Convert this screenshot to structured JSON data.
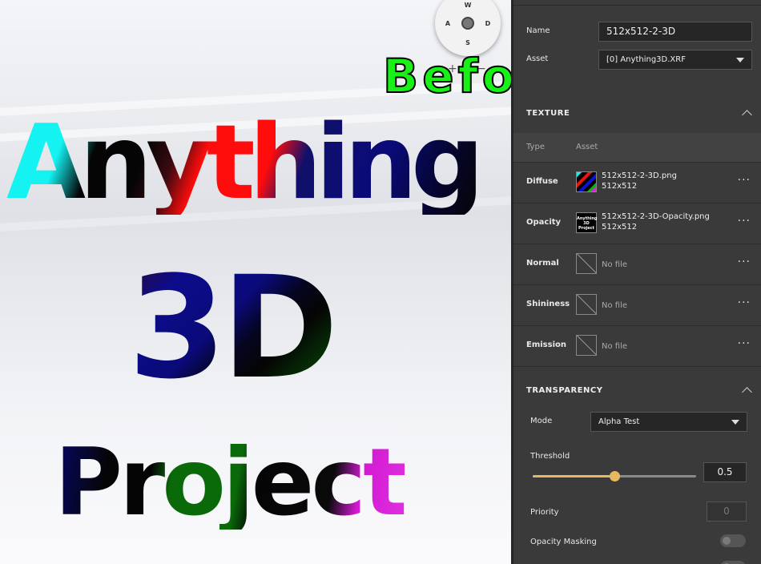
{
  "viewport": {
    "text_lines": [
      "Anything",
      "3D",
      "Project"
    ],
    "overlay_label": "Before",
    "compass": {
      "north": "W",
      "west": "A",
      "east": "D",
      "south": "S"
    },
    "zoom": {
      "in": "+",
      "out": "−"
    }
  },
  "panel": {
    "name_label": "Name",
    "name_value": "512x512-2-3D",
    "asset_label": "Asset",
    "asset_value": "[0] Anything3D.XRF",
    "texture": {
      "title": "TEXTURE",
      "col_type": "Type",
      "col_asset": "Asset",
      "rows": [
        {
          "type": "Diffuse",
          "file": "512x512-2-3D.png",
          "size": "512x512"
        },
        {
          "type": "Opacity",
          "file": "512x512-2-3D-Opacity.png",
          "size": "512x512"
        },
        {
          "type": "Normal",
          "file": "No file",
          "size": ""
        },
        {
          "type": "Shininess",
          "file": "No file",
          "size": ""
        },
        {
          "type": "Emission",
          "file": "No file",
          "size": ""
        }
      ],
      "more_label": "···",
      "opacity_thumb_text": [
        "Anything",
        "3D",
        "Project"
      ]
    },
    "transparency": {
      "title": "TRANSPARENCY",
      "mode_label": "Mode",
      "mode_value": "Alpha Test",
      "threshold_label": "Threshold",
      "threshold_value": "0.5",
      "threshold_fraction": 0.5,
      "priority_label": "Priority",
      "priority_value": "0",
      "opacity_masking_label": "Opacity Masking",
      "opacity_masking_on": false
    }
  },
  "colors": {
    "accent": "#e8b860",
    "overlay_green": "#18f018",
    "panel_bg": "#3a3a3a"
  }
}
